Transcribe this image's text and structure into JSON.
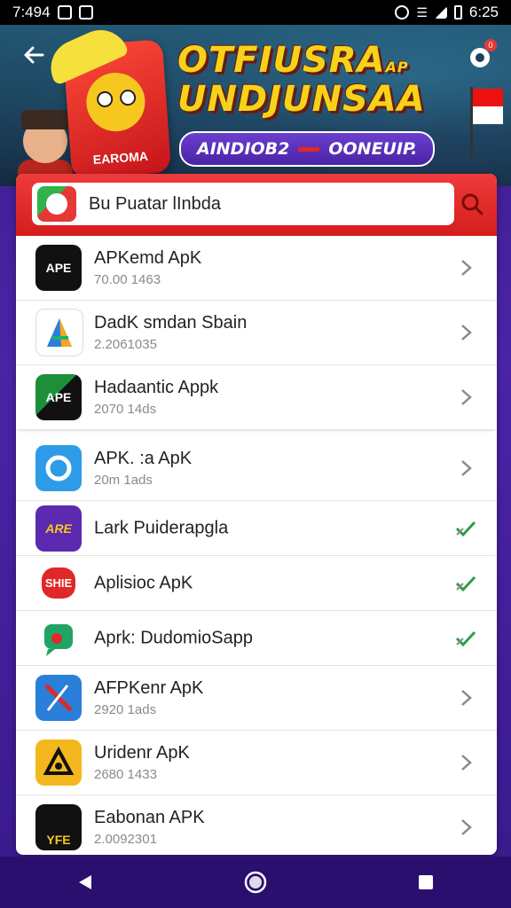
{
  "status_bar": {
    "time_left": "7:494",
    "time_right": "6:25"
  },
  "banner": {
    "headline_line1": "OTFIUSRA",
    "headline_line1_suffix": "AP",
    "headline_line2": "UNDJUNSAA",
    "subtitle_left": "AINDIOB2",
    "subtitle_right": "OONEUIP.",
    "mascot_label": "EAROMA",
    "notification_count": "0"
  },
  "search": {
    "value": "Bu Puatar lInbda"
  },
  "apps": [
    {
      "name": "APKemd ApK",
      "sub": "70.00 1463",
      "icon_label": "APE",
      "icon_bg": "#111111",
      "action": "chevron"
    },
    {
      "name": "DadK smdan Sbain",
      "sub": "2.2061035",
      "icon_label": "A",
      "icon_bg": "#ffffff",
      "action": "chevron"
    },
    {
      "name": "Hadaantic Appk",
      "sub": "2070 14ds",
      "icon_label": "APE",
      "icon_bg": "#111111",
      "action": "chevron"
    },
    {
      "name": "APK. :a ApK",
      "sub": "20m 1ads",
      "icon_label": "",
      "icon_bg": "#2e9be8",
      "action": "chevron"
    },
    {
      "name": "Lark Puiderapgla",
      "sub": "",
      "icon_label": "ARE",
      "icon_bg": "#5b2ab0",
      "action": "check"
    },
    {
      "name": "Aplisioc ApK",
      "sub": "",
      "icon_label": "SHIE",
      "icon_bg": "#ffffff",
      "action": "check"
    },
    {
      "name": "Aprk: DudomioSapp",
      "sub": "",
      "icon_label": "",
      "icon_bg": "#ffffff",
      "action": "check"
    },
    {
      "name": "AFPKenr ApK",
      "sub": "2920 1ads",
      "icon_label": "",
      "icon_bg": "#2a7fd8",
      "action": "chevron"
    },
    {
      "name": "Uridenr ApK",
      "sub": "2680 1433",
      "icon_label": "A",
      "icon_bg": "#f5b71e",
      "action": "chevron"
    },
    {
      "name": "Eabonan APK",
      "sub": "2.0092301",
      "icon_label": "YFE",
      "icon_bg": "#111111",
      "action": "chevron"
    }
  ],
  "colors": {
    "accent_red": "#e02828",
    "check_green": "#2e9d4a",
    "chevron_gray": "#8a8a8a",
    "nav_purple": "#2a0f6e"
  }
}
